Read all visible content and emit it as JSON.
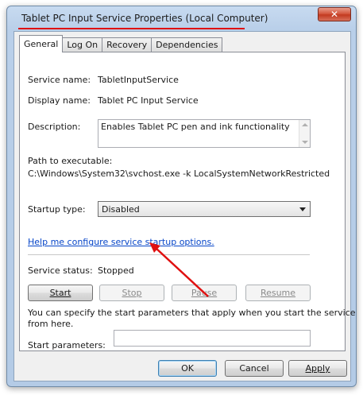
{
  "window": {
    "title": "Tablet PC Input Service Properties (Local Computer)",
    "close_glyph": "✕"
  },
  "tabs": [
    {
      "label": "General",
      "active": true
    },
    {
      "label": "Log On",
      "active": false
    },
    {
      "label": "Recovery",
      "active": false
    },
    {
      "label": "Dependencies",
      "active": false
    }
  ],
  "general": {
    "service_name_label": "Service name:",
    "service_name_value": "TabletInputService",
    "display_name_label": "Display name:",
    "display_name_value": "Tablet PC Input Service",
    "description_label": "Description:",
    "description_value": "Enables Tablet PC pen and ink functionality",
    "path_label": "Path to executable:",
    "path_value": "C:\\Windows\\System32\\svchost.exe -k LocalSystemNetworkRestricted",
    "startup_type_label": "Startup type:",
    "startup_type_value": "Disabled",
    "help_link": "Help me configure service startup options.",
    "service_status_label": "Service status:",
    "service_status_value": "Stopped",
    "buttons": {
      "start": "Start",
      "stop": "Stop",
      "pause": "Pause",
      "resume": "Resume"
    },
    "hint_line1": "You can specify the start parameters that apply when you start the service",
    "hint_line2": "from here.",
    "start_params_label": "Start parameters:",
    "start_params_value": ""
  },
  "footer": {
    "ok": "OK",
    "cancel": "Cancel",
    "apply": "Apply"
  },
  "colors": {
    "annotation_red": "#e01010",
    "link_blue": "#0645c8"
  }
}
